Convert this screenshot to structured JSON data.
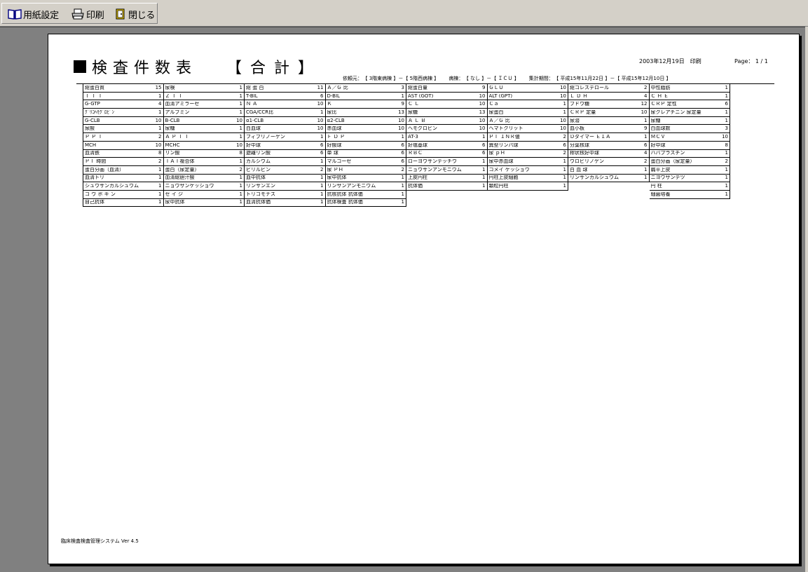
{
  "toolbar": {
    "page_setup_label": "用紙設定",
    "print_label": "印刷",
    "close_label": "閉じる"
  },
  "report": {
    "title": "検査件数表",
    "subtitle": "【合計】",
    "print_date": "2003年12月19日　印刷",
    "page": "Page： 1 / 1",
    "criteria": {
      "dept_label": "依頼元：",
      "dept_value": "【 3階東病棟 】－【 5階西病棟 】",
      "ward_label": "病棟：",
      "ward_value": "【 なし 】－【 ＩＣＵ 】",
      "period_label": "集計期間：",
      "period_value": "【 平成15年11月22日 】－【 平成15年12月10日 】"
    },
    "footer": "臨床検査検査管理システム Ver 4.5"
  },
  "grid": [
    [
      {
        "name": "総蛋白質",
        "count": "15"
      },
      {
        "name": "Ｔ Ｔ Ｔ",
        "count": "1"
      },
      {
        "name": "G-GTP",
        "count": "4"
      },
      {
        "name": "ｸﾞﾘｺﾍﾓｸﾞﾛﾋﾞﾝ",
        "count": "1"
      },
      {
        "name": "G-CLB",
        "count": "10"
      },
      {
        "name": "尿酸",
        "count": "1"
      },
      {
        "name": "Ｐ Ｐ Ｔ",
        "count": "2"
      },
      {
        "name": "MCH",
        "count": "10"
      },
      {
        "name": "血清鉄",
        "count": "8"
      },
      {
        "name": "ＰＴ 時間",
        "count": "2"
      },
      {
        "name": "蛋白分画（血清）",
        "count": "1"
      },
      {
        "name": "血清トリ",
        "count": "1"
      },
      {
        "name": "シュウサンカルシュウム",
        "count": "1"
      },
      {
        "name": "コ ウ ボ キ ン",
        "count": "1"
      },
      {
        "name": "自己抗体",
        "count": "1"
      }
    ],
    [
      {
        "name": "尿検",
        "count": "1"
      },
      {
        "name": "Ｚ Ｔ Ｔ",
        "count": "1"
      },
      {
        "name": "血清アミラーゼ",
        "count": "1"
      },
      {
        "name": "アルブミン",
        "count": "1"
      },
      {
        "name": "B-CLB",
        "count": "10"
      },
      {
        "name": "尿糖",
        "count": "1"
      },
      {
        "name": "Ａ Ｐ Ｔ Ｔ",
        "count": "1"
      },
      {
        "name": "MCHC",
        "count": "10"
      },
      {
        "name": "リン酸",
        "count": "8"
      },
      {
        "name": "ＴＡＴ複合体",
        "count": "1"
      },
      {
        "name": "蛋白（尿定量）",
        "count": "2"
      },
      {
        "name": "血清総胆汁酸",
        "count": "1"
      },
      {
        "name": "ニョウサンケッショウ",
        "count": "1"
      },
      {
        "name": "セ イ ジ",
        "count": "1"
      },
      {
        "name": "尿中抗体",
        "count": "1"
      }
    ],
    [
      {
        "name": "総 蛋 白",
        "count": "11"
      },
      {
        "name": "T-BIL",
        "count": "6"
      },
      {
        "name": "Ｎ Ａ",
        "count": "10"
      },
      {
        "name": "CGA/CCR比",
        "count": "1"
      },
      {
        "name": "α1-CLB",
        "count": "10"
      },
      {
        "name": "白血球",
        "count": "10"
      },
      {
        "name": "フィブリノーゲン",
        "count": "1"
      },
      {
        "name": "好中球",
        "count": "6"
      },
      {
        "name": "遊離リン酸",
        "count": "6"
      },
      {
        "name": "カルシウム",
        "count": "1"
      },
      {
        "name": "ビリルビン",
        "count": "2"
      },
      {
        "name": "血中抗体",
        "count": "1"
      },
      {
        "name": "リンサンエン",
        "count": "1"
      },
      {
        "name": "トリコモナス",
        "count": "1"
      },
      {
        "name": "血清抗体価",
        "count": "1"
      }
    ],
    [
      {
        "name": "Ａ／Ｇ 比",
        "count": "3"
      },
      {
        "name": "D-BIL",
        "count": "1"
      },
      {
        "name": "Ｋ",
        "count": "9"
      },
      {
        "name": "尿比",
        "count": "13"
      },
      {
        "name": "α2-CLB",
        "count": "10"
      },
      {
        "name": "赤血球",
        "count": "10"
      },
      {
        "name": "Ｆ Ｄ Ｐ",
        "count": "1"
      },
      {
        "name": "好酸球",
        "count": "6"
      },
      {
        "name": "単 球",
        "count": "6"
      },
      {
        "name": "マルコーゼ",
        "count": "6"
      },
      {
        "name": "尿 ＰＨ",
        "count": "2"
      },
      {
        "name": "尿中抗体",
        "count": "1"
      },
      {
        "name": "リンサンアンモニウム",
        "count": "1"
      },
      {
        "name": "抗核抗体 抗体価",
        "count": "1"
      },
      {
        "name": "抗体検査 抗体価",
        "count": "1"
      }
    ],
    [
      {
        "name": "総蛋白量",
        "count": "9"
      },
      {
        "name": "AST (GOT)",
        "count": "10"
      },
      {
        "name": "Ｃ Ｌ",
        "count": "10"
      },
      {
        "name": "尿糖",
        "count": "13"
      },
      {
        "name": "Ａ Ｌ Ｂ",
        "count": "10"
      },
      {
        "name": "ヘモグロビン",
        "count": "10"
      },
      {
        "name": "AT-3",
        "count": "1"
      },
      {
        "name": "好塩基球",
        "count": "6"
      },
      {
        "name": "ＲＢＣ",
        "count": "6"
      },
      {
        "name": "ローヨウサンテッチウ",
        "count": "1"
      },
      {
        "name": "ニョウサンアンモニウム",
        "count": "1"
      },
      {
        "name": "上皮円柱",
        "count": "1"
      },
      {
        "name": "抗体価",
        "count": "1"
      },
      {
        "name": "",
        "count": ""
      },
      {
        "name": "",
        "count": ""
      }
    ],
    [
      {
        "name": "ＧＬＵ",
        "count": "10"
      },
      {
        "name": "ALT (GPT)",
        "count": "10"
      },
      {
        "name": "Ｃａ",
        "count": "1"
      },
      {
        "name": "尿蛋白",
        "count": "1"
      },
      {
        "name": "Ａ／Ｇ 比",
        "count": "10"
      },
      {
        "name": "ヘマトクリット",
        "count": "10"
      },
      {
        "name": "ＰＴ ＩＮＲ値",
        "count": "2"
      },
      {
        "name": "異型リンパ球",
        "count": "6"
      },
      {
        "name": "尿 ｐＨ",
        "count": "2"
      },
      {
        "name": "尿中赤血球",
        "count": "1"
      },
      {
        "name": "コメイ ケッショウ",
        "count": "1"
      },
      {
        "name": "円柱上皮細胞",
        "count": "1"
      },
      {
        "name": "顆粒円柱",
        "count": "1"
      },
      {
        "name": "",
        "count": ""
      },
      {
        "name": "",
        "count": ""
      }
    ],
    [
      {
        "name": "総コレステロール",
        "count": "2"
      },
      {
        "name": "Ｌ Ｄ Ｈ",
        "count": "4"
      },
      {
        "name": "ブドウ糖",
        "count": "12"
      },
      {
        "name": "ＣＲＰ 定量",
        "count": "10"
      },
      {
        "name": "尿潜",
        "count": "1"
      },
      {
        "name": "血小板",
        "count": "9"
      },
      {
        "name": "Ｄダイマー ＥＩＡ",
        "count": "1"
      },
      {
        "name": "分葉核球",
        "count": "6"
      },
      {
        "name": "桿状核好中球",
        "count": "4"
      },
      {
        "name": "ウロビリノゲン",
        "count": "2"
      },
      {
        "name": "白 血 球",
        "count": "1"
      },
      {
        "name": "リンサンカルシュウム",
        "count": "1"
      },
      {
        "name": "",
        "count": ""
      },
      {
        "name": "",
        "count": ""
      },
      {
        "name": "",
        "count": ""
      }
    ],
    [
      {
        "name": "中性脂肪",
        "count": "1"
      },
      {
        "name": "Ｃ Ｈ Ｅ",
        "count": "1"
      },
      {
        "name": "ＣＲＰ 定性",
        "count": "6"
      },
      {
        "name": "尿クレアチニン 尿定量",
        "count": "1"
      },
      {
        "name": "尿糖",
        "count": "1"
      },
      {
        "name": "白血球数",
        "count": "3"
      },
      {
        "name": "ＭＣＶ",
        "count": "10"
      },
      {
        "name": "好中球",
        "count": "8"
      },
      {
        "name": "ハバプラスチン",
        "count": "1"
      },
      {
        "name": "蛋白分画（尿定量）",
        "count": "2"
      },
      {
        "name": "扁平上皮",
        "count": "1"
      },
      {
        "name": "ニヨウサンテツ",
        "count": "1"
      },
      {
        "name": "円 柱",
        "count": "1"
      },
      {
        "name": "細菌培養",
        "count": "1"
      },
      {
        "name": "",
        "count": ""
      }
    ]
  ]
}
